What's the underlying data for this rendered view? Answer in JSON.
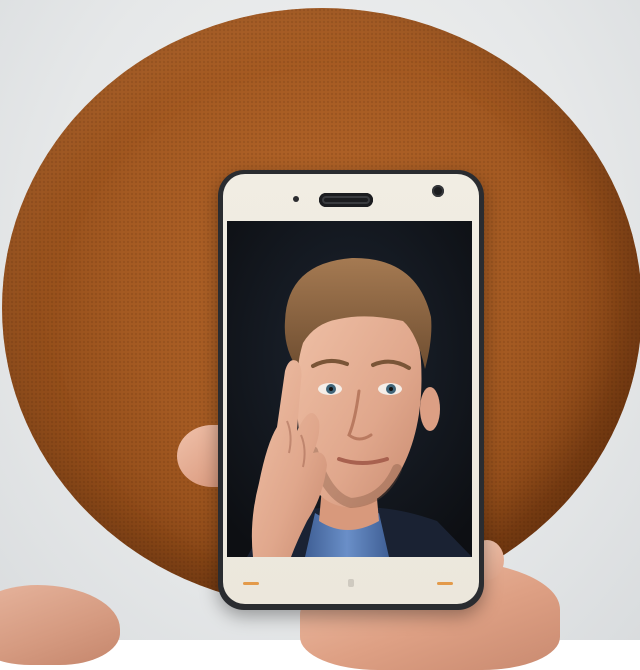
{
  "scene": {
    "description_label": "",
    "colors": {
      "wall": "#e6e8e9",
      "cushion": "#a45a22",
      "phone_body": "#2a2c30",
      "phone_face": "#ece7dc",
      "screen_bg": "#121418",
      "skin": "#e2a98f",
      "shirt": "#5b7fb8",
      "nav_key_accent": "#e39a4a"
    }
  },
  "phone": {
    "front_icons": [
      "earpiece-speaker",
      "proximity-sensor-icon",
      "front-camera-icon"
    ],
    "nav_icons": [
      "back-key-icon",
      "home-key-icon",
      "menu-key-icon"
    ]
  },
  "screen_image": {
    "subject": "portrait"
  }
}
